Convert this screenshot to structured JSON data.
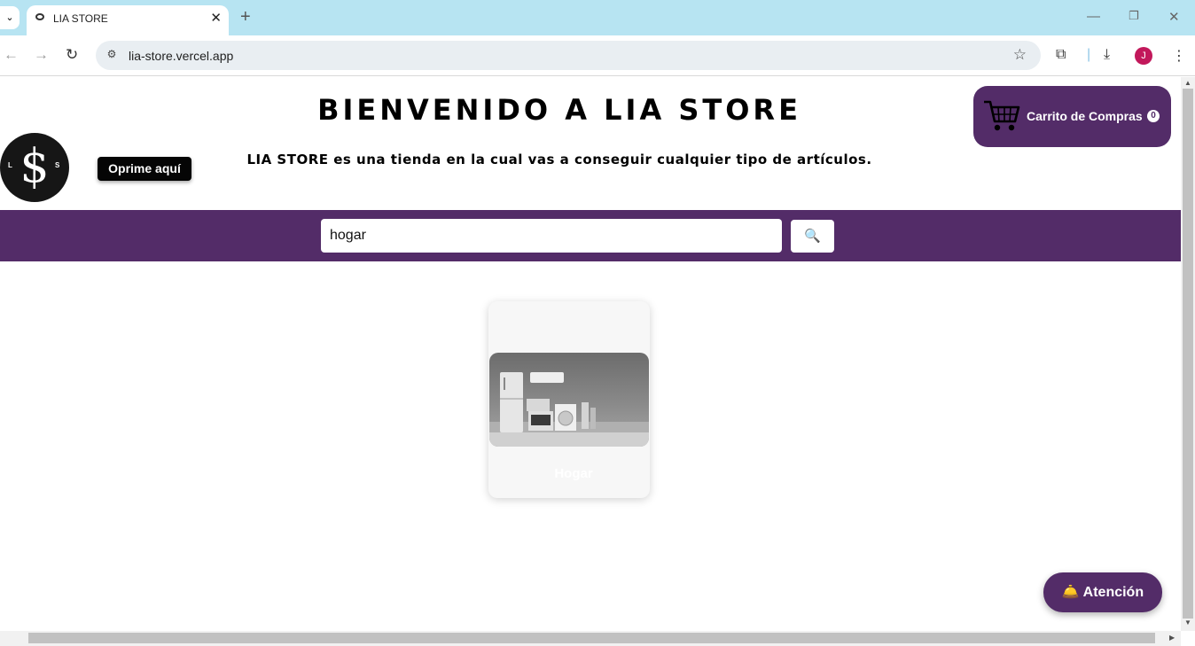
{
  "browser": {
    "tab_title": "LIA STORE",
    "url": "lia-store.vercel.app",
    "avatar_letter": "J",
    "icons": [
      "tab-list-icon",
      "favicon-icon",
      "close-icon",
      "plus-icon",
      "minimize-icon",
      "restore-icon",
      "window-close-icon",
      "back-icon",
      "forward-icon",
      "reload-icon",
      "site-info-icon",
      "star-icon",
      "extensions-icon",
      "download-icon",
      "menu-icon"
    ]
  },
  "header": {
    "title": "BIENVENIDO A LIA STORE",
    "subtitle": "LIA STORE es una tienda en la cual vas a conseguir cualquier tipo de artículos.",
    "press_button": "Oprime aquí",
    "logo_letters": {
      "left": "L",
      "right": "S"
    }
  },
  "cart": {
    "label": "Carrito de Compras",
    "count": "0",
    "icon": "shopping-cart-icon"
  },
  "search": {
    "value": "hogar",
    "placeholder": "",
    "button_icon": "search-icon"
  },
  "products": [
    {
      "title": "Hogar",
      "image": "home-appliances-image"
    }
  ],
  "attention_button": {
    "label": "Atención",
    "icon": "bell-icon"
  },
  "colors": {
    "accent": "#532c68",
    "tab_bar": "#b7e4f2",
    "avatar": "#c2185b"
  }
}
